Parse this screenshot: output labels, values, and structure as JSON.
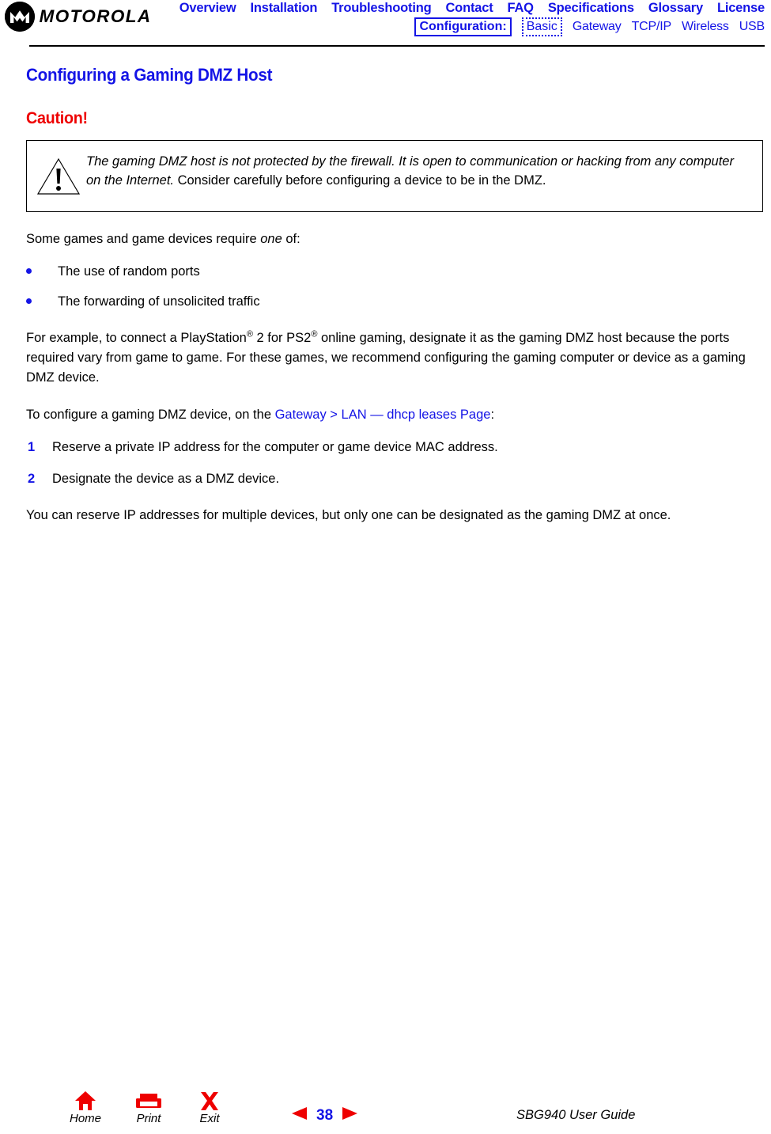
{
  "header": {
    "logo": {
      "mark_icon": "motorola-batwing-icon",
      "wordmark": "MOTOROLA"
    },
    "nav_primary": [
      {
        "label": "Overview"
      },
      {
        "label": "Installation"
      },
      {
        "label": "Troubleshooting"
      },
      {
        "label": "Contact"
      },
      {
        "label": "FAQ"
      },
      {
        "label": "Specifications"
      },
      {
        "label": "Glossary"
      },
      {
        "label": "License"
      }
    ],
    "nav_secondary": {
      "section_label": "Configuration:",
      "items": [
        {
          "label": "Basic",
          "selected": true
        },
        {
          "label": "Gateway",
          "selected": false
        },
        {
          "label": "TCP/IP",
          "selected": false
        },
        {
          "label": "Wireless",
          "selected": false
        },
        {
          "label": "USB",
          "selected": false
        }
      ]
    }
  },
  "content": {
    "page_heading": "Configuring a Gaming DMZ Host",
    "caution_heading": "Caution!",
    "caution_box": {
      "icon": "warning-triangle-icon",
      "emphasis_text": "The gaming DMZ host is not protected by the firewall. It is open to communication or hacking from any computer on the Internet.",
      "normal_text": " Consider carefully before configuring a device to be in the DMZ."
    },
    "intro_before_em": "Some games and game devices require ",
    "intro_em": "one",
    "intro_after_em": " of:",
    "bullets": [
      {
        "text": "The use of random ports"
      },
      {
        "text": "The forwarding of unsolicited traffic"
      }
    ],
    "example_paragraph": {
      "part1": "For example, to connect a PlayStation",
      "reg1": "®",
      "part2": " 2 for PS2",
      "reg2": "®",
      "part3": " online gaming, designate it as the gaming DMZ host because the ports required vary from game to game. For these games, we recommend configuring the gaming computer or device as a gaming DMZ device."
    },
    "instruction_paragraph": {
      "prefix": "To configure a gaming DMZ device, on the ",
      "link": "Gateway > LAN — dhcp leases Page",
      "suffix": ":"
    },
    "steps": [
      {
        "number": "1",
        "text": "Reserve a private IP address for the computer or game device MAC address."
      },
      {
        "number": "2",
        "text": "Designate the device as a DMZ device."
      }
    ],
    "closing_paragraph": "You can reserve IP addresses for multiple devices, but only one can be designated as the gaming DMZ at once."
  },
  "footer": {
    "tools": [
      {
        "id": "home",
        "icon": "home-icon",
        "label": "Home"
      },
      {
        "id": "print",
        "icon": "printer-icon",
        "label": "Print"
      },
      {
        "id": "exit",
        "icon": "exit-x-icon",
        "label": "Exit"
      }
    ],
    "pager": {
      "prev_icon": "triangle-left-icon",
      "page_number": "38",
      "next_icon": "triangle-right-icon"
    },
    "guide_title": "SBG940 User Guide"
  },
  "colors": {
    "link_blue": "#1414e6",
    "caution_red": "#ee0000",
    "text_black": "#000000",
    "page_background": "#ffffff"
  }
}
